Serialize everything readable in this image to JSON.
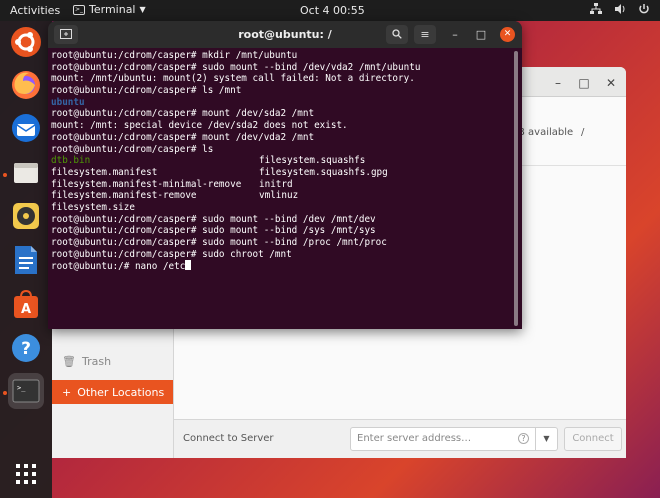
{
  "topbar": {
    "activities": "Activities",
    "app_name": "Terminal",
    "clock": "Oct 4  00:55"
  },
  "dock": {
    "items": [
      "ubuntu-logo",
      "firefox",
      "thunderbird",
      "files",
      "rhythmbox",
      "libreoffice-writer",
      "software",
      "help",
      "terminal",
      "show-applications"
    ]
  },
  "files": {
    "available": "B available",
    "slash": "/",
    "trash_label": "Trash",
    "other_locations": "Other Locations",
    "connect_label": "Connect to Server",
    "server_placeholder": "Enter server address…",
    "connect_button": "Connect"
  },
  "terminal": {
    "title": "root@ubuntu: /",
    "lines": [
      {
        "text": "root@ubuntu:/cdrom/casper# mkdir /mnt/ubuntu"
      },
      {
        "text": "root@ubuntu:/cdrom/casper# sudo mount --bind /dev/vda2 /mnt/ubuntu"
      },
      {
        "text": "mount: /mnt/ubuntu: mount(2) system call failed: Not a directory."
      },
      {
        "text": "root@ubuntu:/cdrom/casper# ls /mnt"
      },
      {
        "text": "ubuntu",
        "color": "blue"
      },
      {
        "text": "root@ubuntu:/cdrom/casper# mount /dev/sda2 /mnt"
      },
      {
        "text": "mount: /mnt: special device /dev/sda2 does not exist."
      },
      {
        "text": "root@ubuntu:/cdrom/casper# mount /dev/vda2 /mnt"
      },
      {
        "text": "root@ubuntu:/cdrom/casper# ls"
      },
      {
        "cols": [
          {
            "text": "dtb.bin",
            "color": "green"
          },
          {
            "text": "filesystem.squashfs"
          }
        ]
      },
      {
        "cols": [
          {
            "text": "filesystem.manifest"
          },
          {
            "text": "filesystem.squashfs.gpg"
          }
        ]
      },
      {
        "cols": [
          {
            "text": "filesystem.manifest-minimal-remove"
          },
          {
            "text": "initrd"
          }
        ]
      },
      {
        "cols": [
          {
            "text": "filesystem.manifest-remove"
          },
          {
            "text": "vmlinuz"
          }
        ]
      },
      {
        "text": "filesystem.size"
      },
      {
        "text": "root@ubuntu:/cdrom/casper# sudo mount --bind /dev /mnt/dev"
      },
      {
        "text": "root@ubuntu:/cdrom/casper# sudo mount --bind /sys /mnt/sys"
      },
      {
        "text": "root@ubuntu:/cdrom/casper# sudo mount --bind /proc /mnt/proc"
      },
      {
        "text": "root@ubuntu:/cdrom/casper# sudo chroot /mnt"
      },
      {
        "text": "root@ubuntu:/# nano /etc",
        "cursor": true
      }
    ]
  },
  "colors": {
    "accent": "#e95420",
    "terminal_bg": "#300a24",
    "dir_blue": "#3465a4",
    "exec_green": "#4e9a06"
  }
}
